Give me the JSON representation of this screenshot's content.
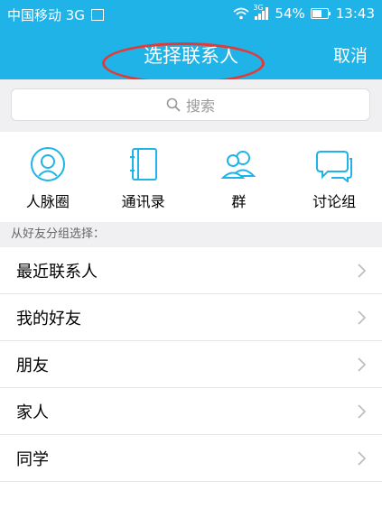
{
  "status_bar": {
    "carrier": "中国移动 3G",
    "battery": "54%",
    "time": "13:43",
    "net_badge": "3G"
  },
  "header": {
    "title": "选择联系人",
    "cancel": "取消"
  },
  "search": {
    "placeholder": "搜索"
  },
  "shortcuts": [
    {
      "label": "人脉圈",
      "icon": "profile-circle-icon"
    },
    {
      "label": "通讯录",
      "icon": "address-book-icon"
    },
    {
      "label": "群",
      "icon": "group-icon"
    },
    {
      "label": "讨论组",
      "icon": "chat-bubbles-icon"
    }
  ],
  "section_label": "从好友分组选择：",
  "groups": [
    "最近联系人",
    "我的好友",
    "朋友",
    "家人",
    "同学"
  ],
  "colors": {
    "accent": "#1fb3e8",
    "highlight_circle": "#e53935"
  }
}
